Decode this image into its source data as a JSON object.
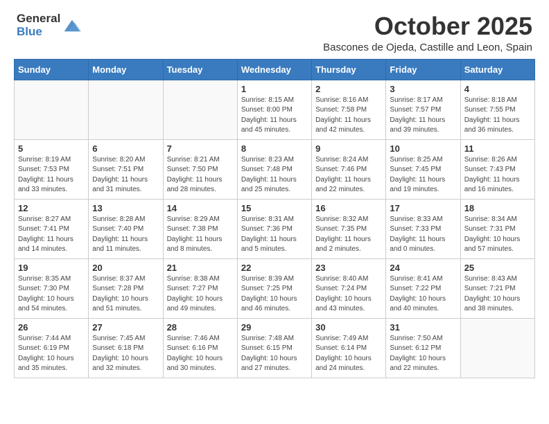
{
  "logo": {
    "general": "General",
    "blue": "Blue"
  },
  "header": {
    "month": "October 2025",
    "location": "Bascones de Ojeda, Castille and Leon, Spain"
  },
  "weekdays": [
    "Sunday",
    "Monday",
    "Tuesday",
    "Wednesday",
    "Thursday",
    "Friday",
    "Saturday"
  ],
  "weeks": [
    [
      {
        "day": "",
        "info": ""
      },
      {
        "day": "",
        "info": ""
      },
      {
        "day": "",
        "info": ""
      },
      {
        "day": "1",
        "info": "Sunrise: 8:15 AM\nSunset: 8:00 PM\nDaylight: 11 hours and 45 minutes."
      },
      {
        "day": "2",
        "info": "Sunrise: 8:16 AM\nSunset: 7:58 PM\nDaylight: 11 hours and 42 minutes."
      },
      {
        "day": "3",
        "info": "Sunrise: 8:17 AM\nSunset: 7:57 PM\nDaylight: 11 hours and 39 minutes."
      },
      {
        "day": "4",
        "info": "Sunrise: 8:18 AM\nSunset: 7:55 PM\nDaylight: 11 hours and 36 minutes."
      }
    ],
    [
      {
        "day": "5",
        "info": "Sunrise: 8:19 AM\nSunset: 7:53 PM\nDaylight: 11 hours and 33 minutes."
      },
      {
        "day": "6",
        "info": "Sunrise: 8:20 AM\nSunset: 7:51 PM\nDaylight: 11 hours and 31 minutes."
      },
      {
        "day": "7",
        "info": "Sunrise: 8:21 AM\nSunset: 7:50 PM\nDaylight: 11 hours and 28 minutes."
      },
      {
        "day": "8",
        "info": "Sunrise: 8:23 AM\nSunset: 7:48 PM\nDaylight: 11 hours and 25 minutes."
      },
      {
        "day": "9",
        "info": "Sunrise: 8:24 AM\nSunset: 7:46 PM\nDaylight: 11 hours and 22 minutes."
      },
      {
        "day": "10",
        "info": "Sunrise: 8:25 AM\nSunset: 7:45 PM\nDaylight: 11 hours and 19 minutes."
      },
      {
        "day": "11",
        "info": "Sunrise: 8:26 AM\nSunset: 7:43 PM\nDaylight: 11 hours and 16 minutes."
      }
    ],
    [
      {
        "day": "12",
        "info": "Sunrise: 8:27 AM\nSunset: 7:41 PM\nDaylight: 11 hours and 14 minutes."
      },
      {
        "day": "13",
        "info": "Sunrise: 8:28 AM\nSunset: 7:40 PM\nDaylight: 11 hours and 11 minutes."
      },
      {
        "day": "14",
        "info": "Sunrise: 8:29 AM\nSunset: 7:38 PM\nDaylight: 11 hours and 8 minutes."
      },
      {
        "day": "15",
        "info": "Sunrise: 8:31 AM\nSunset: 7:36 PM\nDaylight: 11 hours and 5 minutes."
      },
      {
        "day": "16",
        "info": "Sunrise: 8:32 AM\nSunset: 7:35 PM\nDaylight: 11 hours and 2 minutes."
      },
      {
        "day": "17",
        "info": "Sunrise: 8:33 AM\nSunset: 7:33 PM\nDaylight: 11 hours and 0 minutes."
      },
      {
        "day": "18",
        "info": "Sunrise: 8:34 AM\nSunset: 7:31 PM\nDaylight: 10 hours and 57 minutes."
      }
    ],
    [
      {
        "day": "19",
        "info": "Sunrise: 8:35 AM\nSunset: 7:30 PM\nDaylight: 10 hours and 54 minutes."
      },
      {
        "day": "20",
        "info": "Sunrise: 8:37 AM\nSunset: 7:28 PM\nDaylight: 10 hours and 51 minutes."
      },
      {
        "day": "21",
        "info": "Sunrise: 8:38 AM\nSunset: 7:27 PM\nDaylight: 10 hours and 49 minutes."
      },
      {
        "day": "22",
        "info": "Sunrise: 8:39 AM\nSunset: 7:25 PM\nDaylight: 10 hours and 46 minutes."
      },
      {
        "day": "23",
        "info": "Sunrise: 8:40 AM\nSunset: 7:24 PM\nDaylight: 10 hours and 43 minutes."
      },
      {
        "day": "24",
        "info": "Sunrise: 8:41 AM\nSunset: 7:22 PM\nDaylight: 10 hours and 40 minutes."
      },
      {
        "day": "25",
        "info": "Sunrise: 8:43 AM\nSunset: 7:21 PM\nDaylight: 10 hours and 38 minutes."
      }
    ],
    [
      {
        "day": "26",
        "info": "Sunrise: 7:44 AM\nSunset: 6:19 PM\nDaylight: 10 hours and 35 minutes."
      },
      {
        "day": "27",
        "info": "Sunrise: 7:45 AM\nSunset: 6:18 PM\nDaylight: 10 hours and 32 minutes."
      },
      {
        "day": "28",
        "info": "Sunrise: 7:46 AM\nSunset: 6:16 PM\nDaylight: 10 hours and 30 minutes."
      },
      {
        "day": "29",
        "info": "Sunrise: 7:48 AM\nSunset: 6:15 PM\nDaylight: 10 hours and 27 minutes."
      },
      {
        "day": "30",
        "info": "Sunrise: 7:49 AM\nSunset: 6:14 PM\nDaylight: 10 hours and 24 minutes."
      },
      {
        "day": "31",
        "info": "Sunrise: 7:50 AM\nSunset: 6:12 PM\nDaylight: 10 hours and 22 minutes."
      },
      {
        "day": "",
        "info": ""
      }
    ]
  ]
}
